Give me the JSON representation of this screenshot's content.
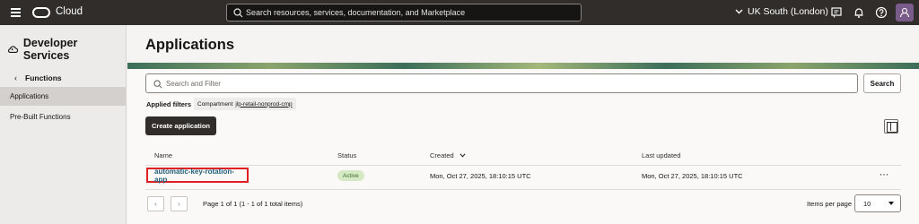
{
  "topbar": {
    "brand": "Cloud",
    "search_placeholder": "Search resources, services, documentation, and Marketplace",
    "region": "UK South (London)"
  },
  "sidebar": {
    "service_title": "Developer Services",
    "back_label": "Functions",
    "items": [
      {
        "label": "Applications",
        "active": true
      },
      {
        "label": "Pre-Built Functions",
        "active": false
      }
    ]
  },
  "main": {
    "title": "Applications",
    "filter_placeholder": "Search and Filter",
    "search_button": "Search",
    "applied_filters_label": "Applied filters",
    "chip_key": "Compartment",
    "chip_value": "jlp-retail-nonprod-cmp",
    "create_button": "Create application",
    "table": {
      "headers": {
        "name": "Name",
        "status": "Status",
        "created": "Created",
        "updated": "Last updated"
      },
      "rows": [
        {
          "name": "automatic-key-rotation-app",
          "status": "Active",
          "created": "Mon, Oct 27, 2025, 18:10:15 UTC",
          "updated": "Mon, Oct 27, 2025, 18:10:15 UTC"
        }
      ]
    },
    "pagination": {
      "info": "Page 1 of 1 (1 - 1 of 1 total items)",
      "items_per_page_label": "Items per page",
      "items_per_page": "10"
    }
  },
  "colors": {
    "topbar_bg": "#312d2a",
    "link": "#1f5f7a",
    "highlight_border": "#e02020",
    "status_active_bg": "#d6e9c5"
  },
  "icons": [
    "hamburger-icon",
    "oracle-logo-icon",
    "search-icon",
    "chevron-down-icon",
    "chat-icon",
    "bell-icon",
    "help-icon",
    "user-icon",
    "cloud-icon",
    "chevron-left-icon",
    "chevron-right-icon",
    "columns-icon",
    "more-icon"
  ]
}
